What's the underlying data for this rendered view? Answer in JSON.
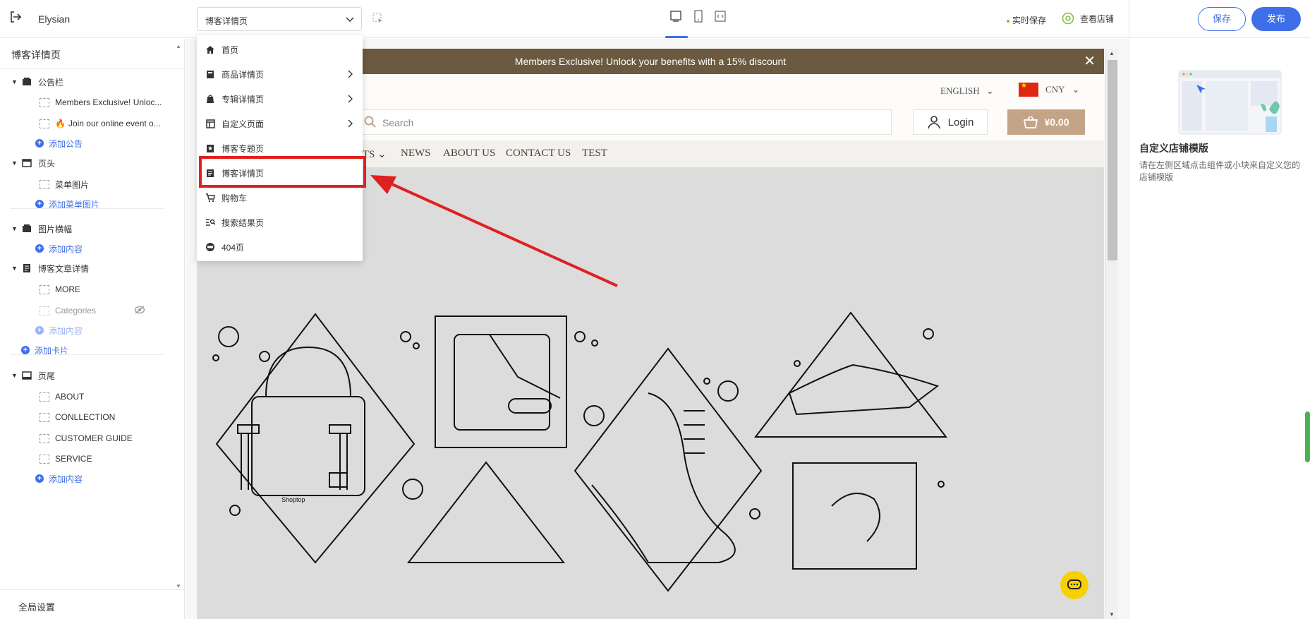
{
  "topbar": {
    "app_title": "Elysian",
    "page_select_value": "博客详情页",
    "autosave_label": "实时保存",
    "view_store_label": "查看店铺",
    "save_label": "保存",
    "publish_label": "发布"
  },
  "sidebar": {
    "title": "博客详情页",
    "sections": {
      "announcement": {
        "label": "公告栏",
        "items": [
          "Members Exclusive! Unloc...",
          "Join our online event o..."
        ],
        "add_label": "添加公告"
      },
      "header": {
        "label": "页头",
        "items": [
          "菜单图片"
        ],
        "add_label": "添加菜单图片"
      },
      "banner": {
        "label": "图片横幅",
        "add_label": "添加内容"
      },
      "blog_detail": {
        "label": "博客文章详情",
        "items": [
          "MORE",
          "Categories"
        ],
        "add_label": "添加内容"
      },
      "add_card_label": "添加卡片",
      "footer": {
        "label": "页尾",
        "items": [
          "ABOUT",
          "CONLLECTION",
          "CUSTOMER GUIDE",
          "SERVICE"
        ],
        "add_label": "添加内容"
      }
    },
    "global_settings_label": "全局设置"
  },
  "dropdown": {
    "items": [
      {
        "label": "首页",
        "icon": "home-icon",
        "has_submenu": false
      },
      {
        "label": "商品详情页",
        "icon": "product-icon",
        "has_submenu": true
      },
      {
        "label": "专辑详情页",
        "icon": "album-icon",
        "has_submenu": true
      },
      {
        "label": "自定义页面",
        "icon": "layout-icon",
        "has_submenu": true
      },
      {
        "label": "博客专题页",
        "icon": "blog-topic-icon",
        "has_submenu": false
      },
      {
        "label": "博客详情页",
        "icon": "document-icon",
        "has_submenu": false,
        "highlighted": true
      },
      {
        "label": "购物车",
        "icon": "cart-icon",
        "has_submenu": false
      },
      {
        "label": "搜索结果页",
        "icon": "search-list-icon",
        "has_submenu": false
      },
      {
        "label": "404页",
        "icon": "404-icon",
        "has_submenu": false
      }
    ]
  },
  "preview": {
    "announcement_text": "Members Exclusive! Unlock your benefits with a 15% discount",
    "language": "ENGLISH",
    "currency": "CNY",
    "search_placeholder": "Search",
    "login_label": "Login",
    "cart_total": "¥0.00",
    "nav_items": [
      "PRODUCTS",
      "NEWS",
      "ABOUT US",
      "CONTACT US",
      "TEST"
    ],
    "bag_brand": "Shoptop"
  },
  "right_panel": {
    "title": "自定义店铺模版",
    "description": "请在左侧区域点击组件或小块来自定义您的店铺模版"
  },
  "colors": {
    "accent": "#3f6fe8",
    "announcement_bg": "#6b5a3f",
    "cart_bg": "#c4a487",
    "highlight": "#e02020",
    "chat_bubble": "#f7d000",
    "hero_bg": "#dcdcdc"
  }
}
